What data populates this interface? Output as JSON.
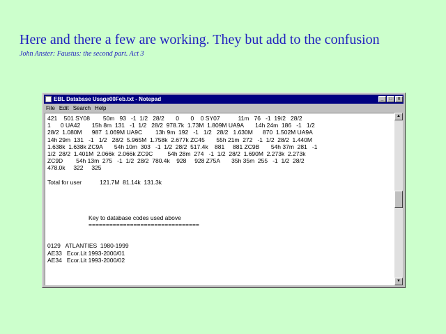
{
  "slide": {
    "title": "Here and there a few are working. They but add to the confusion",
    "subtitle": "John Anster: Faustus: the second part. Act 3"
  },
  "window": {
    "title": "EBL Database Usage00Feb.txt - Notepad",
    "buttons": {
      "minimize": "_",
      "maximize": "□",
      "close": "×"
    }
  },
  "menu": [
    "File",
    "Edit",
    "Search",
    "Help"
  ],
  "document": {
    "lines": [
      "421    501 SY08        50m   93   -1  1/2   28/2       0       0    0 SY07           11m   76   -1  19/2   28/2",
      "1      0 UA42       15h 8m  131   -1  1/2   28/2  978.7k  1.73M  1.809M UA9A       14h 24m  186   -1   1/2",
      "28/2  1.080M      987  1.069M UA9C        13h 9m  192   -1   1/2   28/2   1.630M      870  1.502M UA9A",
      "14h 29m  131   -1   1/2   28/2  5.965M  1.758k  2.677k ZC45       55h 21m  272   -1  1/2  28/2  1.440M",
      "1.638k  1.638k ZC9A       54h 10m  303   -1  1/2  28/2  517.4k    881     881 ZC9B       54h 37m  281   -1",
      "1/2  28/2  1.401M  2.066k  2.066k ZC9C         54h 28m  274   -1  1/2  28/2  1.690M  2.273k  2.273k",
      "ZC9D        54h 13m  275   -1  1/2  28/2  780.4k    928     928 Z75A       35h 35m  255   -1  1/2  28/2",
      "478.0k     322     325",
      "",
      "Total for user           121.7M  81.14k  131.3k",
      "",
      "",
      "",
      "",
      "                         Key to database codes used above",
      "                         ================================",
      "",
      "",
      "0129   ATLANTIES  1980-1999",
      "AE33   Ecor.Lit 1993-2000/01",
      "AE34   Ecor.Lit 1993-2000/02"
    ]
  }
}
